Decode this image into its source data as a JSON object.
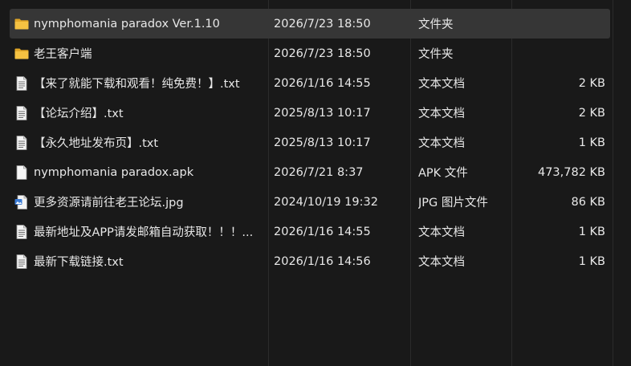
{
  "files": [
    {
      "name": "nymphomania paradox Ver.1.10",
      "date": "2026/7/23 18:50",
      "type": "文件夹",
      "size": "",
      "icon": "folder-icon",
      "selected": true
    },
    {
      "name": "老王客户端",
      "date": "2026/7/23 18:50",
      "type": "文件夹",
      "size": "",
      "icon": "folder-icon",
      "selected": false
    },
    {
      "name": "【来了就能下载和观看！纯免费！】.txt",
      "date": "2026/1/16 14:55",
      "type": "文本文档",
      "size": "2 KB",
      "icon": "text-file-icon",
      "selected": false
    },
    {
      "name": "【论坛介绍】.txt",
      "date": "2025/8/13 10:17",
      "type": "文本文档",
      "size": "2 KB",
      "icon": "text-file-icon",
      "selected": false
    },
    {
      "name": "【永久地址发布页】.txt",
      "date": "2025/8/13 10:17",
      "type": "文本文档",
      "size": "1 KB",
      "icon": "text-file-icon",
      "selected": false
    },
    {
      "name": "nymphomania paradox.apk",
      "date": "2026/7/21 8:37",
      "type": "APK 文件",
      "size": "473,782 KB",
      "icon": "blank-file-icon",
      "selected": false
    },
    {
      "name": "更多资源请前往老王论坛.jpg",
      "date": "2024/10/19 19:32",
      "type": "JPG 图片文件",
      "size": "86 KB",
      "icon": "image-file-icon",
      "selected": false
    },
    {
      "name": "最新地址及APP请发邮箱自动获取！！！...",
      "date": "2026/1/16 14:55",
      "type": "文本文档",
      "size": "1 KB",
      "icon": "text-file-icon",
      "selected": false
    },
    {
      "name": "最新下载链接.txt",
      "date": "2026/1/16 14:56",
      "type": "文本文档",
      "size": "1 KB",
      "icon": "text-file-icon",
      "selected": false
    }
  ],
  "colors": {
    "background": "#191919",
    "selected_row": "#363636",
    "folder": "#f5c242",
    "text": "#e8e8e8"
  }
}
